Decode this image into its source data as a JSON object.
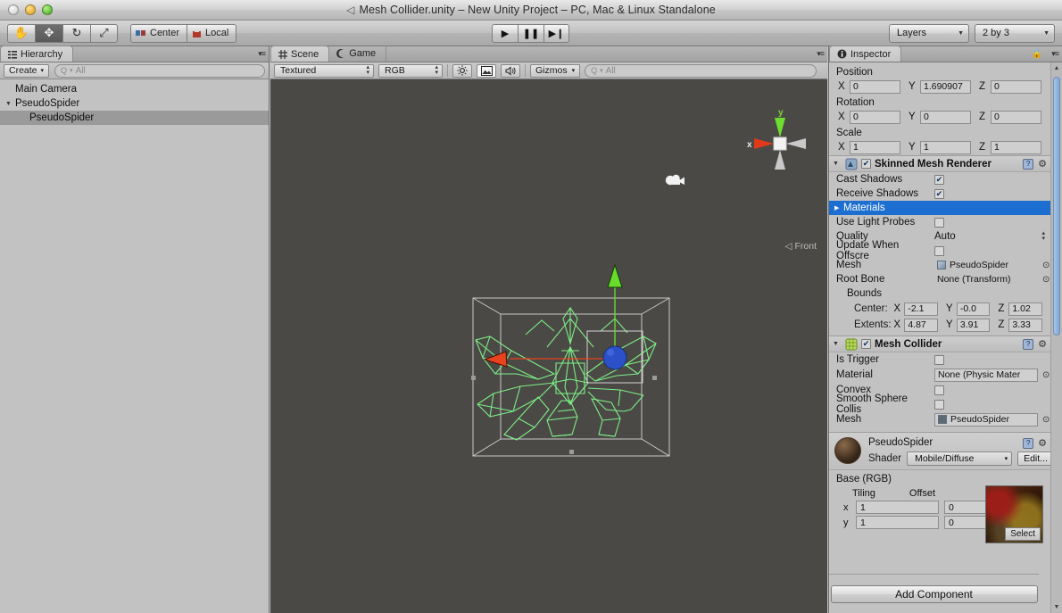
{
  "window": {
    "title": "Mesh Collider.unity – New Unity Project – PC, Mac & Linux Standalone",
    "unity_glyph": "◁"
  },
  "toolbar": {
    "tools": [
      {
        "name": "hand-tool",
        "glyph": "✋",
        "active": false
      },
      {
        "name": "move-tool",
        "glyph": "✥",
        "active": true
      },
      {
        "name": "rotate-tool",
        "glyph": "↻",
        "active": false
      },
      {
        "name": "scale-tool",
        "glyph": "⤢",
        "active": false
      }
    ],
    "pivot_label": "Center",
    "handle_label": "Local",
    "play_label": "▶",
    "pause_label": "❚❚",
    "step_label": "▶❙",
    "layers_label": "Layers",
    "layout_label": "2 by 3",
    "dropdown_arrow": "▼"
  },
  "hierarchy": {
    "tab_label": "Hierarchy",
    "tab_icon": "hierarchy-icon",
    "create_label": "Create",
    "create_arrow": "▾",
    "search_placeholder": "All",
    "search_icon": "Q",
    "items": [
      {
        "label": "Main Camera",
        "depth": 0,
        "expandable": false,
        "selected": false
      },
      {
        "label": "PseudoSpider",
        "depth": 0,
        "expandable": true,
        "selected": false
      },
      {
        "label": "PseudoSpider",
        "depth": 1,
        "expandable": false,
        "selected": true
      }
    ],
    "disclosure_glyph": "▼",
    "menu_glyph": "▾≡"
  },
  "scene": {
    "tabs": [
      {
        "label": "Scene",
        "icon": "grid-icon",
        "active": true
      },
      {
        "label": "Game",
        "icon": "gamepad-icon",
        "active": false
      }
    ],
    "draw_mode": "Textured",
    "color_mode": "RGB",
    "lighting_icon": "sun-icon",
    "fx_icon": "image-icon",
    "audio_icon": "speaker-icon",
    "gizmos_label": "Gizmos",
    "gizmos_arrow": "▾",
    "search_placeholder": "All",
    "menu_glyph": "▾≡",
    "axis": {
      "x_label": "x",
      "y_label": "y",
      "front_label": "Front",
      "front_arrow": "◁",
      "x_color": "#e03a1b",
      "y_color": "#6ddd2f",
      "gray_color": "#c9c9c9"
    },
    "model": {
      "wireframe_color": "#7dee85",
      "bounds_color": "#c8c8c8",
      "gizmo_x_color": "#e8431c",
      "gizmo_y_color": "#67dd2a",
      "gizmo_z_color": "#2b50c8"
    }
  },
  "inspector": {
    "tab_label": "Inspector",
    "tab_icon": "info-icon",
    "lock_icon": "lock-icon",
    "menu_glyph": "▾≡",
    "transform": {
      "position_label": "Position",
      "rotation_label": "Rotation",
      "scale_label": "Scale",
      "axes": [
        "X",
        "Y",
        "Z"
      ],
      "position": [
        "0",
        "1.690907",
        "0"
      ],
      "rotation": [
        "0",
        "0",
        "0"
      ],
      "scale": [
        "1",
        "1",
        "1"
      ]
    },
    "skinned_mesh_renderer": {
      "title": "Skinned Mesh Renderer",
      "enabled": true,
      "checkmark": "✔",
      "fold": "▼",
      "help_glyph": "?",
      "gear_glyph": "✿",
      "rows": [
        {
          "name": "Cast Shadows",
          "type": "checkbox",
          "value": true
        },
        {
          "name": "Receive Shadows",
          "type": "checkbox",
          "value": true
        },
        {
          "name": "Materials",
          "type": "foldout",
          "selected": true
        },
        {
          "name": "Use Light Probes",
          "type": "checkbox",
          "value": false
        },
        {
          "name": "Quality",
          "type": "enum",
          "value": "Auto"
        },
        {
          "name": "Update When Offscre",
          "type": "checkbox",
          "value": false
        },
        {
          "name": "Mesh",
          "type": "object",
          "value": "PseudoSpider"
        },
        {
          "name": "Root Bone",
          "type": "object-plain",
          "value": "None (Transform)"
        }
      ],
      "bounds_label": "Bounds",
      "center_label": "Center:",
      "extents_label": "Extents:",
      "center": [
        "-2.1",
        "-0.0",
        "1.02"
      ],
      "extents": [
        "4.87",
        "3.91",
        "3.33"
      ],
      "axes": [
        "X",
        "Y",
        "Z"
      ]
    },
    "mesh_collider": {
      "title": "Mesh Collider",
      "enabled": true,
      "checkmark": "✔",
      "fold": "▼",
      "rows": [
        {
          "name": "Is Trigger",
          "type": "checkbox",
          "value": false
        },
        {
          "name": "Material",
          "type": "object",
          "value": "None (Physic Mater"
        },
        {
          "name": "Convex",
          "type": "checkbox",
          "value": false
        },
        {
          "name": "Smooth Sphere Collis",
          "type": "checkbox",
          "value": false
        },
        {
          "name": "Mesh",
          "type": "object",
          "value": "PseudoSpider"
        }
      ]
    },
    "material": {
      "name": "PseudoSpider",
      "shader_label": "Shader",
      "shader_value": "Mobile/Diffuse",
      "shader_arrow": "▾",
      "edit_label": "Edit...",
      "texture_prop_label": "Base (RGB)",
      "tiling_label": "Tiling",
      "offset_label": "Offset",
      "rows": [
        {
          "axis": "x",
          "tiling": "1",
          "offset": "0"
        },
        {
          "axis": "y",
          "tiling": "1",
          "offset": "0"
        }
      ],
      "select_label": "Select"
    },
    "add_component_label": "Add Component",
    "scroll_up": "▲",
    "scroll_down": "▼"
  }
}
